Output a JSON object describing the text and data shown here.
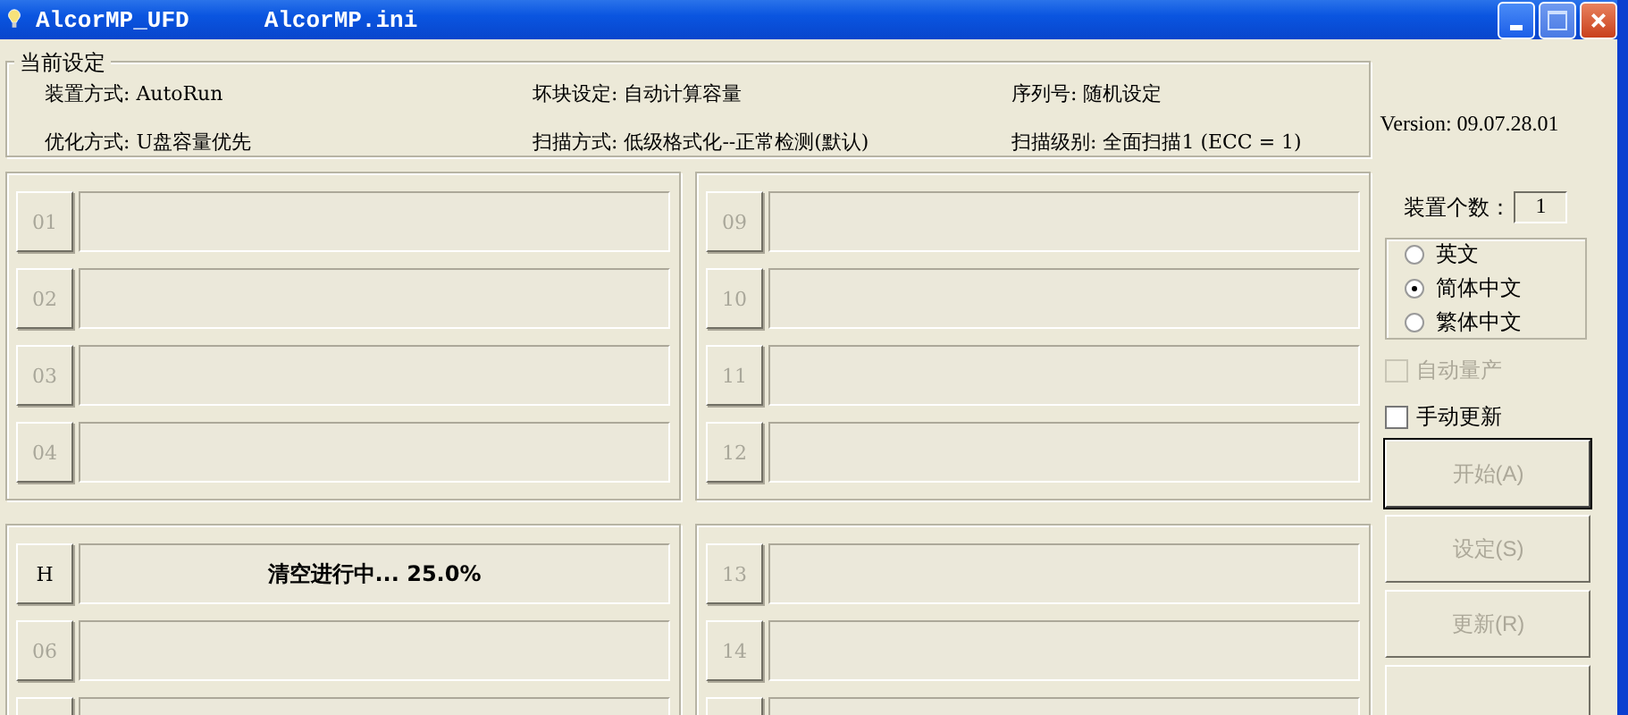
{
  "window": {
    "title": "AlcorMP_UFD",
    "file": "AlcorMP.ini"
  },
  "current_settings": {
    "title": "当前设定",
    "items": [
      {
        "label": "装置方式: AutoRun"
      },
      {
        "label": "坏块设定: 自动计算容量"
      },
      {
        "label": "序列号: 随机设定"
      },
      {
        "label": "优化方式: U盘容量优先"
      },
      {
        "label": "扫描方式: 低级格式化--正常检测(默认)"
      },
      {
        "label": "扫描级别: 全面扫描1 (ECC = 1)"
      }
    ]
  },
  "version": "Version: 09.07.28.01",
  "port_groups": [
    {
      "slots": [
        {
          "kind": "port",
          "label": "01",
          "active": false
        },
        {
          "kind": "port",
          "label": "02",
          "active": false
        },
        {
          "kind": "port",
          "label": "03",
          "active": false
        },
        {
          "kind": "port",
          "label": "04",
          "active": false
        }
      ]
    },
    {
      "slots": [
        {
          "kind": "port",
          "label": "09",
          "active": false
        },
        {
          "kind": "port",
          "label": "10",
          "active": false
        },
        {
          "kind": "port",
          "label": "11",
          "active": false
        },
        {
          "kind": "port",
          "label": "12",
          "active": false
        }
      ]
    },
    {
      "slots": [
        {
          "kind": "port",
          "label": "H",
          "active": true,
          "status": "清空进行中... 25.0%"
        },
        {
          "kind": "port",
          "label": "06",
          "active": false
        },
        {
          "kind": "cut"
        }
      ]
    },
    {
      "slots": [
        {
          "kind": "port",
          "label": "13",
          "active": false
        },
        {
          "kind": "port",
          "label": "14",
          "active": false
        },
        {
          "kind": "cut"
        }
      ]
    }
  ],
  "device_count": {
    "label": "装置个数：",
    "value": "1"
  },
  "languages": [
    {
      "label": "英文",
      "selected": false
    },
    {
      "label": "简体中文",
      "selected": true
    },
    {
      "label": "繁体中文",
      "selected": false
    }
  ],
  "checkboxes": [
    {
      "label": "自动量产",
      "checked": false,
      "disabled": true
    },
    {
      "label": "手动更新",
      "checked": false,
      "disabled": false
    }
  ],
  "buttons": [
    {
      "label": "开始(A)",
      "default": true,
      "disabled": true
    },
    {
      "label": "设定(S)",
      "default": false,
      "disabled": true
    },
    {
      "label": "更新(R)",
      "default": false,
      "disabled": true
    },
    {
      "default": false
    }
  ]
}
